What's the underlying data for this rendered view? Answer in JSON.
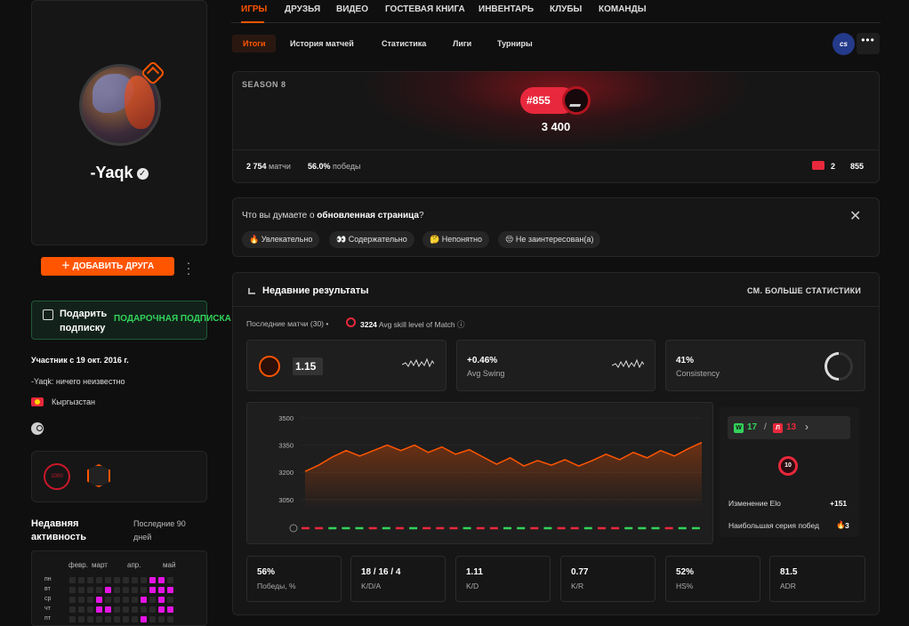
{
  "profile": {
    "nickname": "-Yaqk",
    "add_friend": "ДОБАВИТЬ ДРУГА",
    "gift_text": "Подарить подписку",
    "gift_link": "ПОДАРОЧНАЯ ПОДПИСКА",
    "member_since": "Участник с 19 окт. 2016 г.",
    "bio": "-Yaqk: ничего неизвестно",
    "country": "Кыргызстан",
    "badge_1000": "1000",
    "recent_activity_title": "Недавняя активность",
    "recent_activity_range": "Последние 90 дней",
    "months": [
      "февр.",
      "март",
      "апр.",
      "май"
    ],
    "days": [
      "пн",
      "вт",
      "ср",
      "чт",
      "пт",
      "сб"
    ]
  },
  "nav": {
    "tabs": [
      "ИГРЫ",
      "ДРУЗЬЯ",
      "ВИДЕО",
      "ГОСТЕВАЯ КНИГА",
      "ИНВЕНТАРЬ",
      "КЛУБЫ",
      "КОМАНДЫ"
    ],
    "subtabs": [
      "Итоги",
      "История матчей",
      "Статистика",
      "Лиги",
      "Турниры"
    ],
    "game_logo": "cs",
    "more": "•••"
  },
  "season": {
    "label": "SEASON 8",
    "rank": "#855",
    "elo": "3 400",
    "matches_value": "2 754",
    "matches_label": "матчи",
    "wins_value": "56.0%",
    "wins_label": "победы",
    "country_rank_level": "2",
    "country_rank": "855"
  },
  "feedback": {
    "question_pre": "Что вы думаете о ",
    "question_bold": "обновленная страница",
    "question_post": "?",
    "chips": [
      "🔥 Увлекательно",
      "👀 Содержательно",
      "🤔 Непонятно",
      "😒 Не заинтересован(а)"
    ],
    "close": "✕"
  },
  "results": {
    "title": "Недавние результаты",
    "see_more": "СМ. БОЛЬШЕ СТАТИСТИКИ",
    "recent_matches": "Последние матчи (30)",
    "bullet": "•",
    "skill_value": "3224",
    "skill_label": "Avg skill level of Match",
    "info": "ⓘ",
    "kd_value": "1.15",
    "swing_value": "+0.46%",
    "swing_label": "Avg Swing",
    "consistency_value": "41%",
    "consistency_label": "Consistency",
    "wins": "17",
    "losses": "13",
    "w_letter": "W",
    "l_letter": "Л",
    "slash": "/",
    "chevron": "›",
    "skill_level": "10",
    "elo_change_label": "Изменение Elo",
    "elo_change_value": "+151",
    "streak_label": "Наибольшая серия побед",
    "streak_value": "3",
    "bottom_stats": [
      {
        "value": "56%",
        "label": "Победы, %"
      },
      {
        "value": "18 / 16 / 4",
        "label": "K/D/A"
      },
      {
        "value": "1.11",
        "label": "K/D"
      },
      {
        "value": "0.77",
        "label": "K/R"
      },
      {
        "value": "52%",
        "label": "HS%"
      },
      {
        "value": "81.5",
        "label": "ADR"
      }
    ]
  },
  "chart_data": {
    "type": "area",
    "title": "",
    "xlabel": "",
    "ylabel": "",
    "ylim": [
      3000,
      3500
    ],
    "yticks": [
      "3500",
      "3350",
      "3200",
      "3050"
    ],
    "values": [
      3205,
      3240,
      3285,
      3320,
      3290,
      3320,
      3350,
      3320,
      3350,
      3310,
      3340,
      3300,
      3325,
      3285,
      3245,
      3280,
      3235,
      3265,
      3240,
      3270,
      3235,
      3265,
      3300,
      3270,
      3310,
      3280,
      3320,
      3290,
      3330,
      3365
    ],
    "results": [
      "L",
      "L",
      "W",
      "W",
      "W",
      "L",
      "W",
      "L",
      "W",
      "L",
      "L",
      "L",
      "W",
      "L",
      "L",
      "W",
      "W",
      "L",
      "W",
      "L",
      "L",
      "W",
      "L",
      "L",
      "W",
      "W",
      "W",
      "L",
      "W",
      "W"
    ],
    "colors": {
      "line": "#ff5500",
      "win": "#32d35a",
      "loss": "#e8283c"
    }
  },
  "colors": {
    "accent": "#ff5500",
    "win": "#32d35a",
    "loss": "#e8283c",
    "gift": "#32d35a",
    "activity": "#e414e4"
  }
}
